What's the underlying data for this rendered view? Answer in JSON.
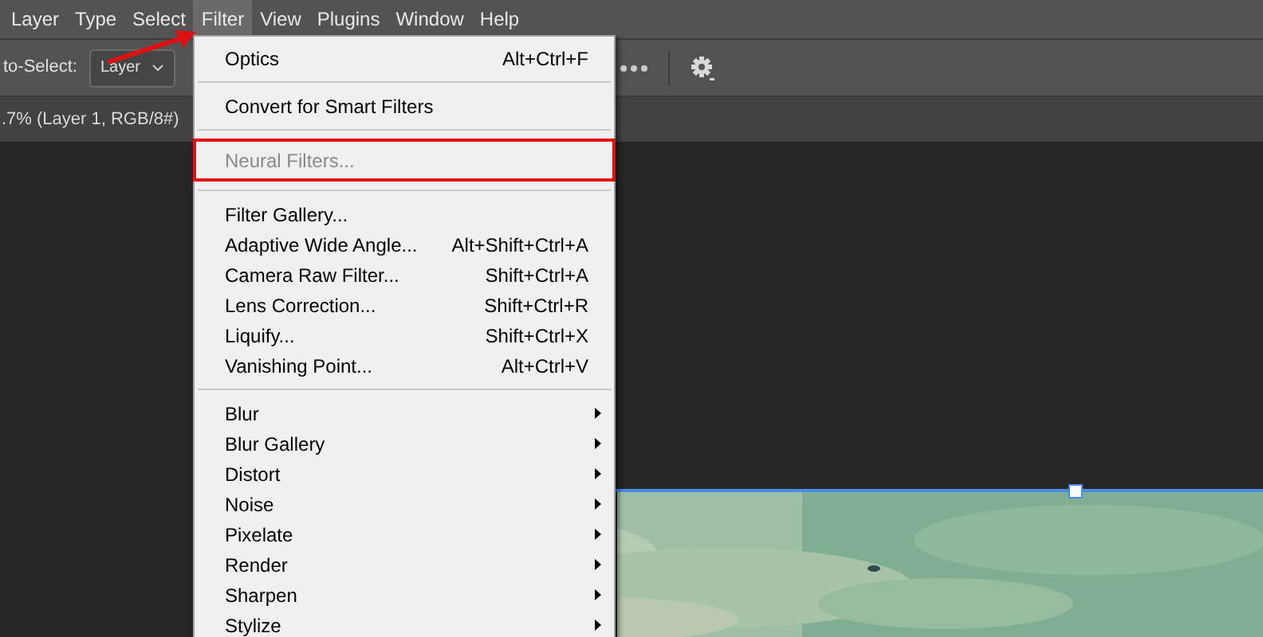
{
  "menu_bar": [
    {
      "label": "Layer",
      "selected": false
    },
    {
      "label": "Type",
      "selected": false
    },
    {
      "label": "Select",
      "selected": false
    },
    {
      "label": "Filter",
      "selected": true
    },
    {
      "label": "View",
      "selected": false
    },
    {
      "label": "Plugins",
      "selected": false
    },
    {
      "label": "Window",
      "selected": false
    },
    {
      "label": "Help",
      "selected": false
    }
  ],
  "options_bar": {
    "label": "to-Select:",
    "dropdown": {
      "value": "Layer"
    }
  },
  "document_tab": {
    "title": ".7% (Layer 1, RGB/8#)"
  },
  "filter_menu": [
    {
      "kind": "item",
      "label": "Optics",
      "shortcut": "Alt+Ctrl+F",
      "disabled": false,
      "highlighted": false
    },
    {
      "kind": "separator"
    },
    {
      "kind": "item",
      "label": "Convert for Smart Filters",
      "disabled": false,
      "highlighted": false
    },
    {
      "kind": "separator"
    },
    {
      "kind": "item",
      "label": "Neural Filters...",
      "disabled": true,
      "highlighted": true
    },
    {
      "kind": "separator"
    },
    {
      "kind": "item",
      "label": "Filter Gallery...",
      "disabled": false,
      "highlighted": false
    },
    {
      "kind": "item",
      "label": "Adaptive Wide Angle...",
      "shortcut": "Alt+Shift+Ctrl+A",
      "disabled": false,
      "highlighted": false
    },
    {
      "kind": "item",
      "label": "Camera Raw Filter...",
      "shortcut": "Shift+Ctrl+A",
      "disabled": false,
      "highlighted": false
    },
    {
      "kind": "item",
      "label": "Lens Correction...",
      "shortcut": "Shift+Ctrl+R",
      "disabled": false,
      "highlighted": false
    },
    {
      "kind": "item",
      "label": "Liquify...",
      "shortcut": "Shift+Ctrl+X",
      "disabled": false,
      "highlighted": false
    },
    {
      "kind": "item",
      "label": "Vanishing Point...",
      "shortcut": "Alt+Ctrl+V",
      "disabled": false,
      "highlighted": false
    },
    {
      "kind": "separator"
    },
    {
      "kind": "submenu",
      "label": "Blur"
    },
    {
      "kind": "submenu",
      "label": "Blur Gallery"
    },
    {
      "kind": "submenu",
      "label": "Distort"
    },
    {
      "kind": "submenu",
      "label": "Noise"
    },
    {
      "kind": "submenu",
      "label": "Pixelate"
    },
    {
      "kind": "submenu",
      "label": "Render"
    },
    {
      "kind": "submenu",
      "label": "Sharpen"
    },
    {
      "kind": "submenu",
      "label": "Stylize"
    }
  ]
}
